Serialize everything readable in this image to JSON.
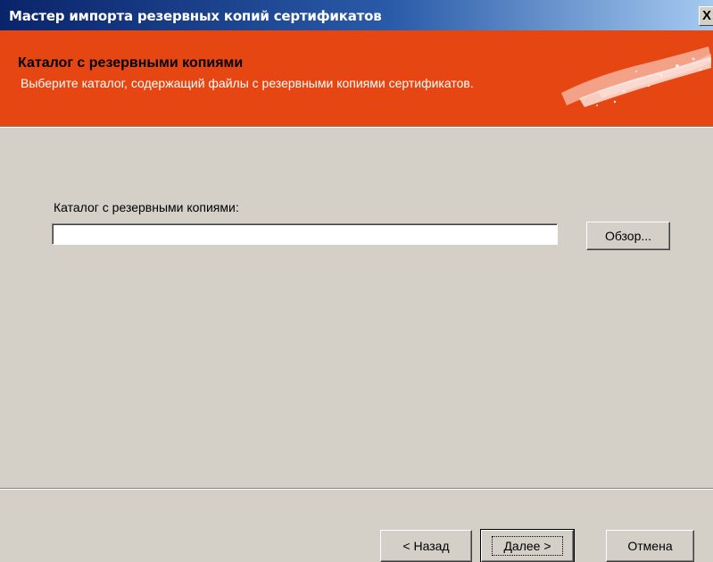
{
  "window": {
    "title": "Мастер импорта резервных копий сертификатов",
    "close_glyph": "X"
  },
  "header": {
    "title": "Каталог с резервными копиями",
    "description": "Выберите каталог, содержащий файлы с резервными копиями сертификатов."
  },
  "form": {
    "folder_label": "Каталог с резервными копиями:",
    "folder_value": "",
    "browse_label": "Обзор..."
  },
  "footer": {
    "back_label": "< Назад",
    "next_label": "Далее >",
    "cancel_label": "Отмена"
  },
  "colors": {
    "banner": "#e64612",
    "titlebar_start": "#0a246a",
    "titlebar_end": "#a6caf0",
    "dialog_bg": "#d4d0c8"
  },
  "icons": {
    "banner_art": "certificate-stamp-icon",
    "close": "close-icon"
  }
}
